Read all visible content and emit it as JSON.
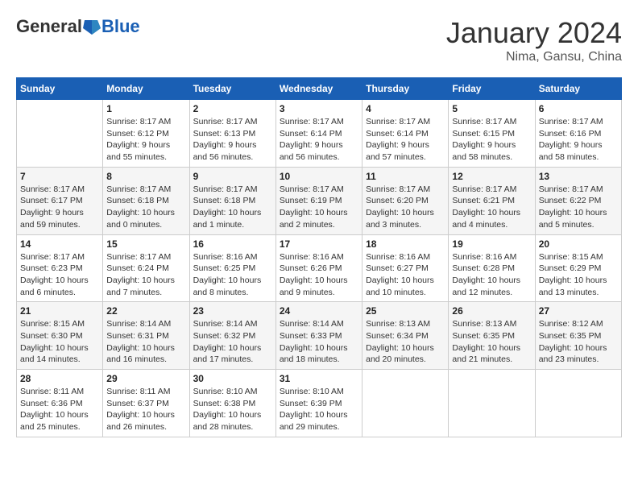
{
  "header": {
    "logo_general": "General",
    "logo_blue": "Blue",
    "month": "January 2024",
    "location": "Nima, Gansu, China"
  },
  "days_of_week": [
    "Sunday",
    "Monday",
    "Tuesday",
    "Wednesday",
    "Thursday",
    "Friday",
    "Saturday"
  ],
  "weeks": [
    [
      {
        "day": "",
        "sunrise": "",
        "sunset": "",
        "daylight": ""
      },
      {
        "day": "1",
        "sunrise": "Sunrise: 8:17 AM",
        "sunset": "Sunset: 6:12 PM",
        "daylight": "Daylight: 9 hours and 55 minutes."
      },
      {
        "day": "2",
        "sunrise": "Sunrise: 8:17 AM",
        "sunset": "Sunset: 6:13 PM",
        "daylight": "Daylight: 9 hours and 56 minutes."
      },
      {
        "day": "3",
        "sunrise": "Sunrise: 8:17 AM",
        "sunset": "Sunset: 6:14 PM",
        "daylight": "Daylight: 9 hours and 56 minutes."
      },
      {
        "day": "4",
        "sunrise": "Sunrise: 8:17 AM",
        "sunset": "Sunset: 6:14 PM",
        "daylight": "Daylight: 9 hours and 57 minutes."
      },
      {
        "day": "5",
        "sunrise": "Sunrise: 8:17 AM",
        "sunset": "Sunset: 6:15 PM",
        "daylight": "Daylight: 9 hours and 58 minutes."
      },
      {
        "day": "6",
        "sunrise": "Sunrise: 8:17 AM",
        "sunset": "Sunset: 6:16 PM",
        "daylight": "Daylight: 9 hours and 58 minutes."
      }
    ],
    [
      {
        "day": "7",
        "sunrise": "Sunrise: 8:17 AM",
        "sunset": "Sunset: 6:17 PM",
        "daylight": "Daylight: 9 hours and 59 minutes."
      },
      {
        "day": "8",
        "sunrise": "Sunrise: 8:17 AM",
        "sunset": "Sunset: 6:18 PM",
        "daylight": "Daylight: 10 hours and 0 minutes."
      },
      {
        "day": "9",
        "sunrise": "Sunrise: 8:17 AM",
        "sunset": "Sunset: 6:18 PM",
        "daylight": "Daylight: 10 hours and 1 minute."
      },
      {
        "day": "10",
        "sunrise": "Sunrise: 8:17 AM",
        "sunset": "Sunset: 6:19 PM",
        "daylight": "Daylight: 10 hours and 2 minutes."
      },
      {
        "day": "11",
        "sunrise": "Sunrise: 8:17 AM",
        "sunset": "Sunset: 6:20 PM",
        "daylight": "Daylight: 10 hours and 3 minutes."
      },
      {
        "day": "12",
        "sunrise": "Sunrise: 8:17 AM",
        "sunset": "Sunset: 6:21 PM",
        "daylight": "Daylight: 10 hours and 4 minutes."
      },
      {
        "day": "13",
        "sunrise": "Sunrise: 8:17 AM",
        "sunset": "Sunset: 6:22 PM",
        "daylight": "Daylight: 10 hours and 5 minutes."
      }
    ],
    [
      {
        "day": "14",
        "sunrise": "Sunrise: 8:17 AM",
        "sunset": "Sunset: 6:23 PM",
        "daylight": "Daylight: 10 hours and 6 minutes."
      },
      {
        "day": "15",
        "sunrise": "Sunrise: 8:17 AM",
        "sunset": "Sunset: 6:24 PM",
        "daylight": "Daylight: 10 hours and 7 minutes."
      },
      {
        "day": "16",
        "sunrise": "Sunrise: 8:16 AM",
        "sunset": "Sunset: 6:25 PM",
        "daylight": "Daylight: 10 hours and 8 minutes."
      },
      {
        "day": "17",
        "sunrise": "Sunrise: 8:16 AM",
        "sunset": "Sunset: 6:26 PM",
        "daylight": "Daylight: 10 hours and 9 minutes."
      },
      {
        "day": "18",
        "sunrise": "Sunrise: 8:16 AM",
        "sunset": "Sunset: 6:27 PM",
        "daylight": "Daylight: 10 hours and 10 minutes."
      },
      {
        "day": "19",
        "sunrise": "Sunrise: 8:16 AM",
        "sunset": "Sunset: 6:28 PM",
        "daylight": "Daylight: 10 hours and 12 minutes."
      },
      {
        "day": "20",
        "sunrise": "Sunrise: 8:15 AM",
        "sunset": "Sunset: 6:29 PM",
        "daylight": "Daylight: 10 hours and 13 minutes."
      }
    ],
    [
      {
        "day": "21",
        "sunrise": "Sunrise: 8:15 AM",
        "sunset": "Sunset: 6:30 PM",
        "daylight": "Daylight: 10 hours and 14 minutes."
      },
      {
        "day": "22",
        "sunrise": "Sunrise: 8:14 AM",
        "sunset": "Sunset: 6:31 PM",
        "daylight": "Daylight: 10 hours and 16 minutes."
      },
      {
        "day": "23",
        "sunrise": "Sunrise: 8:14 AM",
        "sunset": "Sunset: 6:32 PM",
        "daylight": "Daylight: 10 hours and 17 minutes."
      },
      {
        "day": "24",
        "sunrise": "Sunrise: 8:14 AM",
        "sunset": "Sunset: 6:33 PM",
        "daylight": "Daylight: 10 hours and 18 minutes."
      },
      {
        "day": "25",
        "sunrise": "Sunrise: 8:13 AM",
        "sunset": "Sunset: 6:34 PM",
        "daylight": "Daylight: 10 hours and 20 minutes."
      },
      {
        "day": "26",
        "sunrise": "Sunrise: 8:13 AM",
        "sunset": "Sunset: 6:35 PM",
        "daylight": "Daylight: 10 hours and 21 minutes."
      },
      {
        "day": "27",
        "sunrise": "Sunrise: 8:12 AM",
        "sunset": "Sunset: 6:35 PM",
        "daylight": "Daylight: 10 hours and 23 minutes."
      }
    ],
    [
      {
        "day": "28",
        "sunrise": "Sunrise: 8:11 AM",
        "sunset": "Sunset: 6:36 PM",
        "daylight": "Daylight: 10 hours and 25 minutes."
      },
      {
        "day": "29",
        "sunrise": "Sunrise: 8:11 AM",
        "sunset": "Sunset: 6:37 PM",
        "daylight": "Daylight: 10 hours and 26 minutes."
      },
      {
        "day": "30",
        "sunrise": "Sunrise: 8:10 AM",
        "sunset": "Sunset: 6:38 PM",
        "daylight": "Daylight: 10 hours and 28 minutes."
      },
      {
        "day": "31",
        "sunrise": "Sunrise: 8:10 AM",
        "sunset": "Sunset: 6:39 PM",
        "daylight": "Daylight: 10 hours and 29 minutes."
      },
      {
        "day": "",
        "sunrise": "",
        "sunset": "",
        "daylight": ""
      },
      {
        "day": "",
        "sunrise": "",
        "sunset": "",
        "daylight": ""
      },
      {
        "day": "",
        "sunrise": "",
        "sunset": "",
        "daylight": ""
      }
    ]
  ]
}
